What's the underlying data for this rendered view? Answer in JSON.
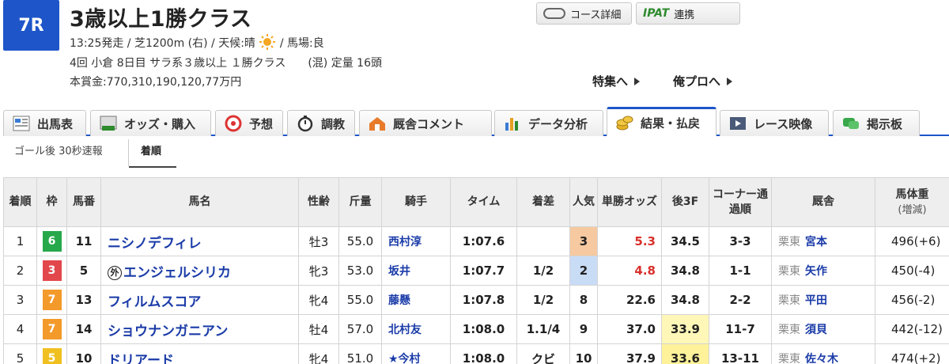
{
  "header": {
    "race_number": "7R",
    "title": "3歳以上1勝クラス",
    "info_line1": "13:25発走 / 芝1200m (右) / 天候:晴",
    "track_condition": "/ 馬場:良",
    "info_line2": "4回 小倉 8日目 サラ系３歳以上 １勝クラス　　(混) 定量 16頭",
    "prize": "本賞金:770,310,190,120,77万円",
    "course_button": "コース詳細",
    "ipat_logo": "IPAT",
    "ipat_button": "連携",
    "link_feature": "特集へ",
    "link_orepro": "俺プロへ"
  },
  "tabs": [
    {
      "label": "出馬表"
    },
    {
      "label": "オッズ・購入"
    },
    {
      "label": "予想"
    },
    {
      "label": "調教"
    },
    {
      "label": "厩舎コメント"
    },
    {
      "label": "データ分析"
    },
    {
      "label": "結果・払戻"
    },
    {
      "label": "レース映像"
    },
    {
      "label": "掲示板"
    }
  ],
  "subtabs": {
    "flash": "ゴール後 30秒速報",
    "order": "着順"
  },
  "table": {
    "headers": {
      "rank": "着順",
      "waku": "枠",
      "umaban": "馬番",
      "horse": "馬名",
      "sex_age": "性齢",
      "weight_carried": "斤量",
      "jockey": "騎手",
      "time": "タイム",
      "margin": "着差",
      "popularity": "人気",
      "odds": "単勝オッズ",
      "last3f": "後3F",
      "corner": "コーナー通過順",
      "stable": "厩舎",
      "body_weight": "馬体重",
      "body_weight_sub": "(増減)"
    },
    "rows": [
      {
        "rank": "1",
        "waku": "6",
        "umaban": "11",
        "horse": "ニシノデフィレ",
        "foreign": "",
        "sex_age": "牡3",
        "kin": "55.0",
        "jockey": "西村淳",
        "time": "1:07.6",
        "margin": "",
        "pop": "3",
        "odds": "5.3",
        "last3f": "34.5",
        "corner": "3-3",
        "region": "栗東",
        "trainer": "宮本",
        "body": "496(+6)"
      },
      {
        "rank": "2",
        "waku": "3",
        "umaban": "5",
        "horse": "エンジェルシリカ",
        "foreign": "外",
        "sex_age": "牝3",
        "kin": "53.0",
        "jockey": "坂井",
        "time": "1:07.7",
        "margin": "1/2",
        "pop": "2",
        "odds": "4.8",
        "last3f": "34.8",
        "corner": "1-1",
        "region": "栗東",
        "trainer": "矢作",
        "body": "450(-4)"
      },
      {
        "rank": "3",
        "waku": "7",
        "umaban": "13",
        "horse": "フィルムスコア",
        "foreign": "",
        "sex_age": "牝4",
        "kin": "55.0",
        "jockey": "藤懸",
        "time": "1:07.8",
        "margin": "1/2",
        "pop": "8",
        "odds": "22.6",
        "last3f": "34.8",
        "corner": "2-2",
        "region": "栗東",
        "trainer": "平田",
        "body": "456(-2)"
      },
      {
        "rank": "4",
        "waku": "7",
        "umaban": "14",
        "horse": "ショウナンガニアン",
        "foreign": "",
        "sex_age": "牡4",
        "kin": "57.0",
        "jockey": "北村友",
        "time": "1:08.0",
        "margin": "1.1/4",
        "pop": "9",
        "odds": "37.0",
        "last3f": "33.9",
        "corner": "11-7",
        "region": "栗東",
        "trainer": "須貝",
        "body": "442(-12)"
      },
      {
        "rank": "5",
        "waku": "5",
        "umaban": "10",
        "horse": "ドリアード",
        "foreign": "",
        "sex_age": "牝4",
        "kin": "51.0",
        "jockey": "★今村",
        "time": "1:08.0",
        "margin": "クビ",
        "pop": "10",
        "odds": "37.9",
        "last3f": "33.6",
        "corner": "13-11",
        "region": "栗東",
        "trainer": "佐々木",
        "body": "474(+2)"
      }
    ]
  },
  "colors": {
    "waku_3": "#e2474b",
    "waku_5": "#f0c020",
    "waku_6": "#27a84a",
    "waku_7": "#f39a2a",
    "accent": "#1e56c9"
  }
}
